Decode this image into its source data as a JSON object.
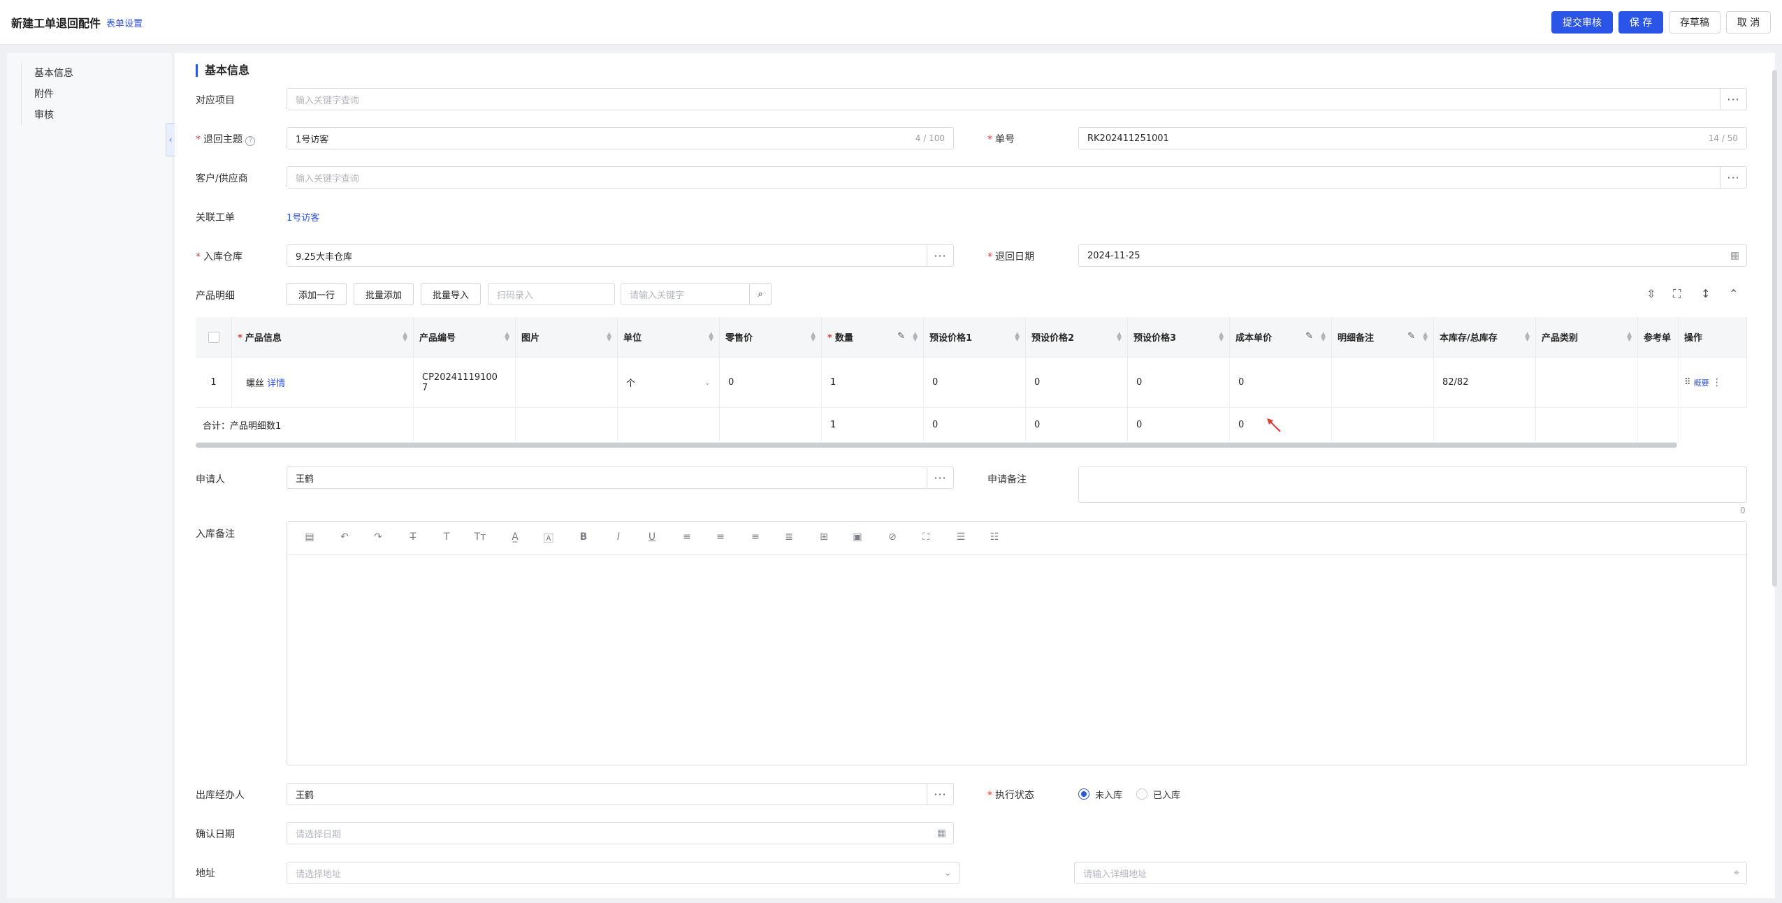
{
  "header": {
    "title": "新建工单退回配件",
    "form_settings": "表单设置",
    "buttons": {
      "submit": "提交审核",
      "save": "保 存",
      "draft": "存草稿",
      "cancel": "取 消"
    }
  },
  "sidebar": {
    "items": [
      {
        "label": "基本信息"
      },
      {
        "label": "附件"
      },
      {
        "label": "审核"
      }
    ]
  },
  "section_title": "基本信息",
  "fields": {
    "project": {
      "label": "对应项目",
      "placeholder": "输入关键字查询"
    },
    "subject": {
      "label": "退回主题",
      "value": "1号访客",
      "count": "4 / 100"
    },
    "order_no": {
      "label": "单号",
      "value": "RK202411251001",
      "count": "14 / 50"
    },
    "customer": {
      "label": "客户/供应商",
      "placeholder": "输入关键字查询"
    },
    "related_ticket": {
      "label": "关联工单",
      "value": "1号访客"
    },
    "warehouse": {
      "label": "入库仓库",
      "value": "9.25大丰仓库"
    },
    "return_date": {
      "label": "退回日期",
      "value": "2024-11-25"
    },
    "product_detail": {
      "label": "产品明细"
    },
    "applicant": {
      "label": "申请人",
      "value": "王鹤"
    },
    "apply_note": {
      "label": "申请备注",
      "count": "0"
    },
    "inbound_note": {
      "label": "入库备注"
    },
    "handler": {
      "label": "出库经办人",
      "value": "王鹤"
    },
    "exec_status": {
      "label": "执行状态",
      "options": [
        "未入库",
        "已入库"
      ],
      "selected": "未入库"
    },
    "confirm_date": {
      "label": "确认日期",
      "placeholder": "请选择日期"
    },
    "address": {
      "label": "地址",
      "placeholder": "请选择地址",
      "detail_placeholder": "请输入详细地址"
    }
  },
  "product_toolbar": {
    "add_row": "添加一行",
    "batch_add": "批量添加",
    "batch_import": "批量导入",
    "scan_placeholder": "扫码录入",
    "search_placeholder": "请输入关键字"
  },
  "table": {
    "columns": [
      "产品信息",
      "产品编号",
      "图片",
      "单位",
      "零售价",
      "数量",
      "预设价格1",
      "预设价格2",
      "预设价格3",
      "成本单价",
      "明细备注",
      "本库存/总库存",
      "产品类别",
      "参考单",
      "操作"
    ],
    "rows": [
      {
        "index": "1",
        "product": "螺丝",
        "detail": "详情",
        "code_line1": "CP20241119100",
        "code_line2": "7",
        "image": "",
        "unit": "个",
        "retail": "0",
        "qty": "1",
        "p1": "0",
        "p2": "0",
        "p3": "0",
        "cost": "0",
        "note": "",
        "stock": "82/82",
        "category": "",
        "ref": "",
        "op_overview": "概要"
      }
    ],
    "summary": {
      "label": "合计：产品明细数1",
      "qty": "1",
      "p1": "0",
      "p2": "0",
      "p3": "0",
      "cost": "0"
    }
  },
  "colors": {
    "primary": "#2b55e6",
    "required": "#e53935",
    "link": "#2f54eb"
  }
}
